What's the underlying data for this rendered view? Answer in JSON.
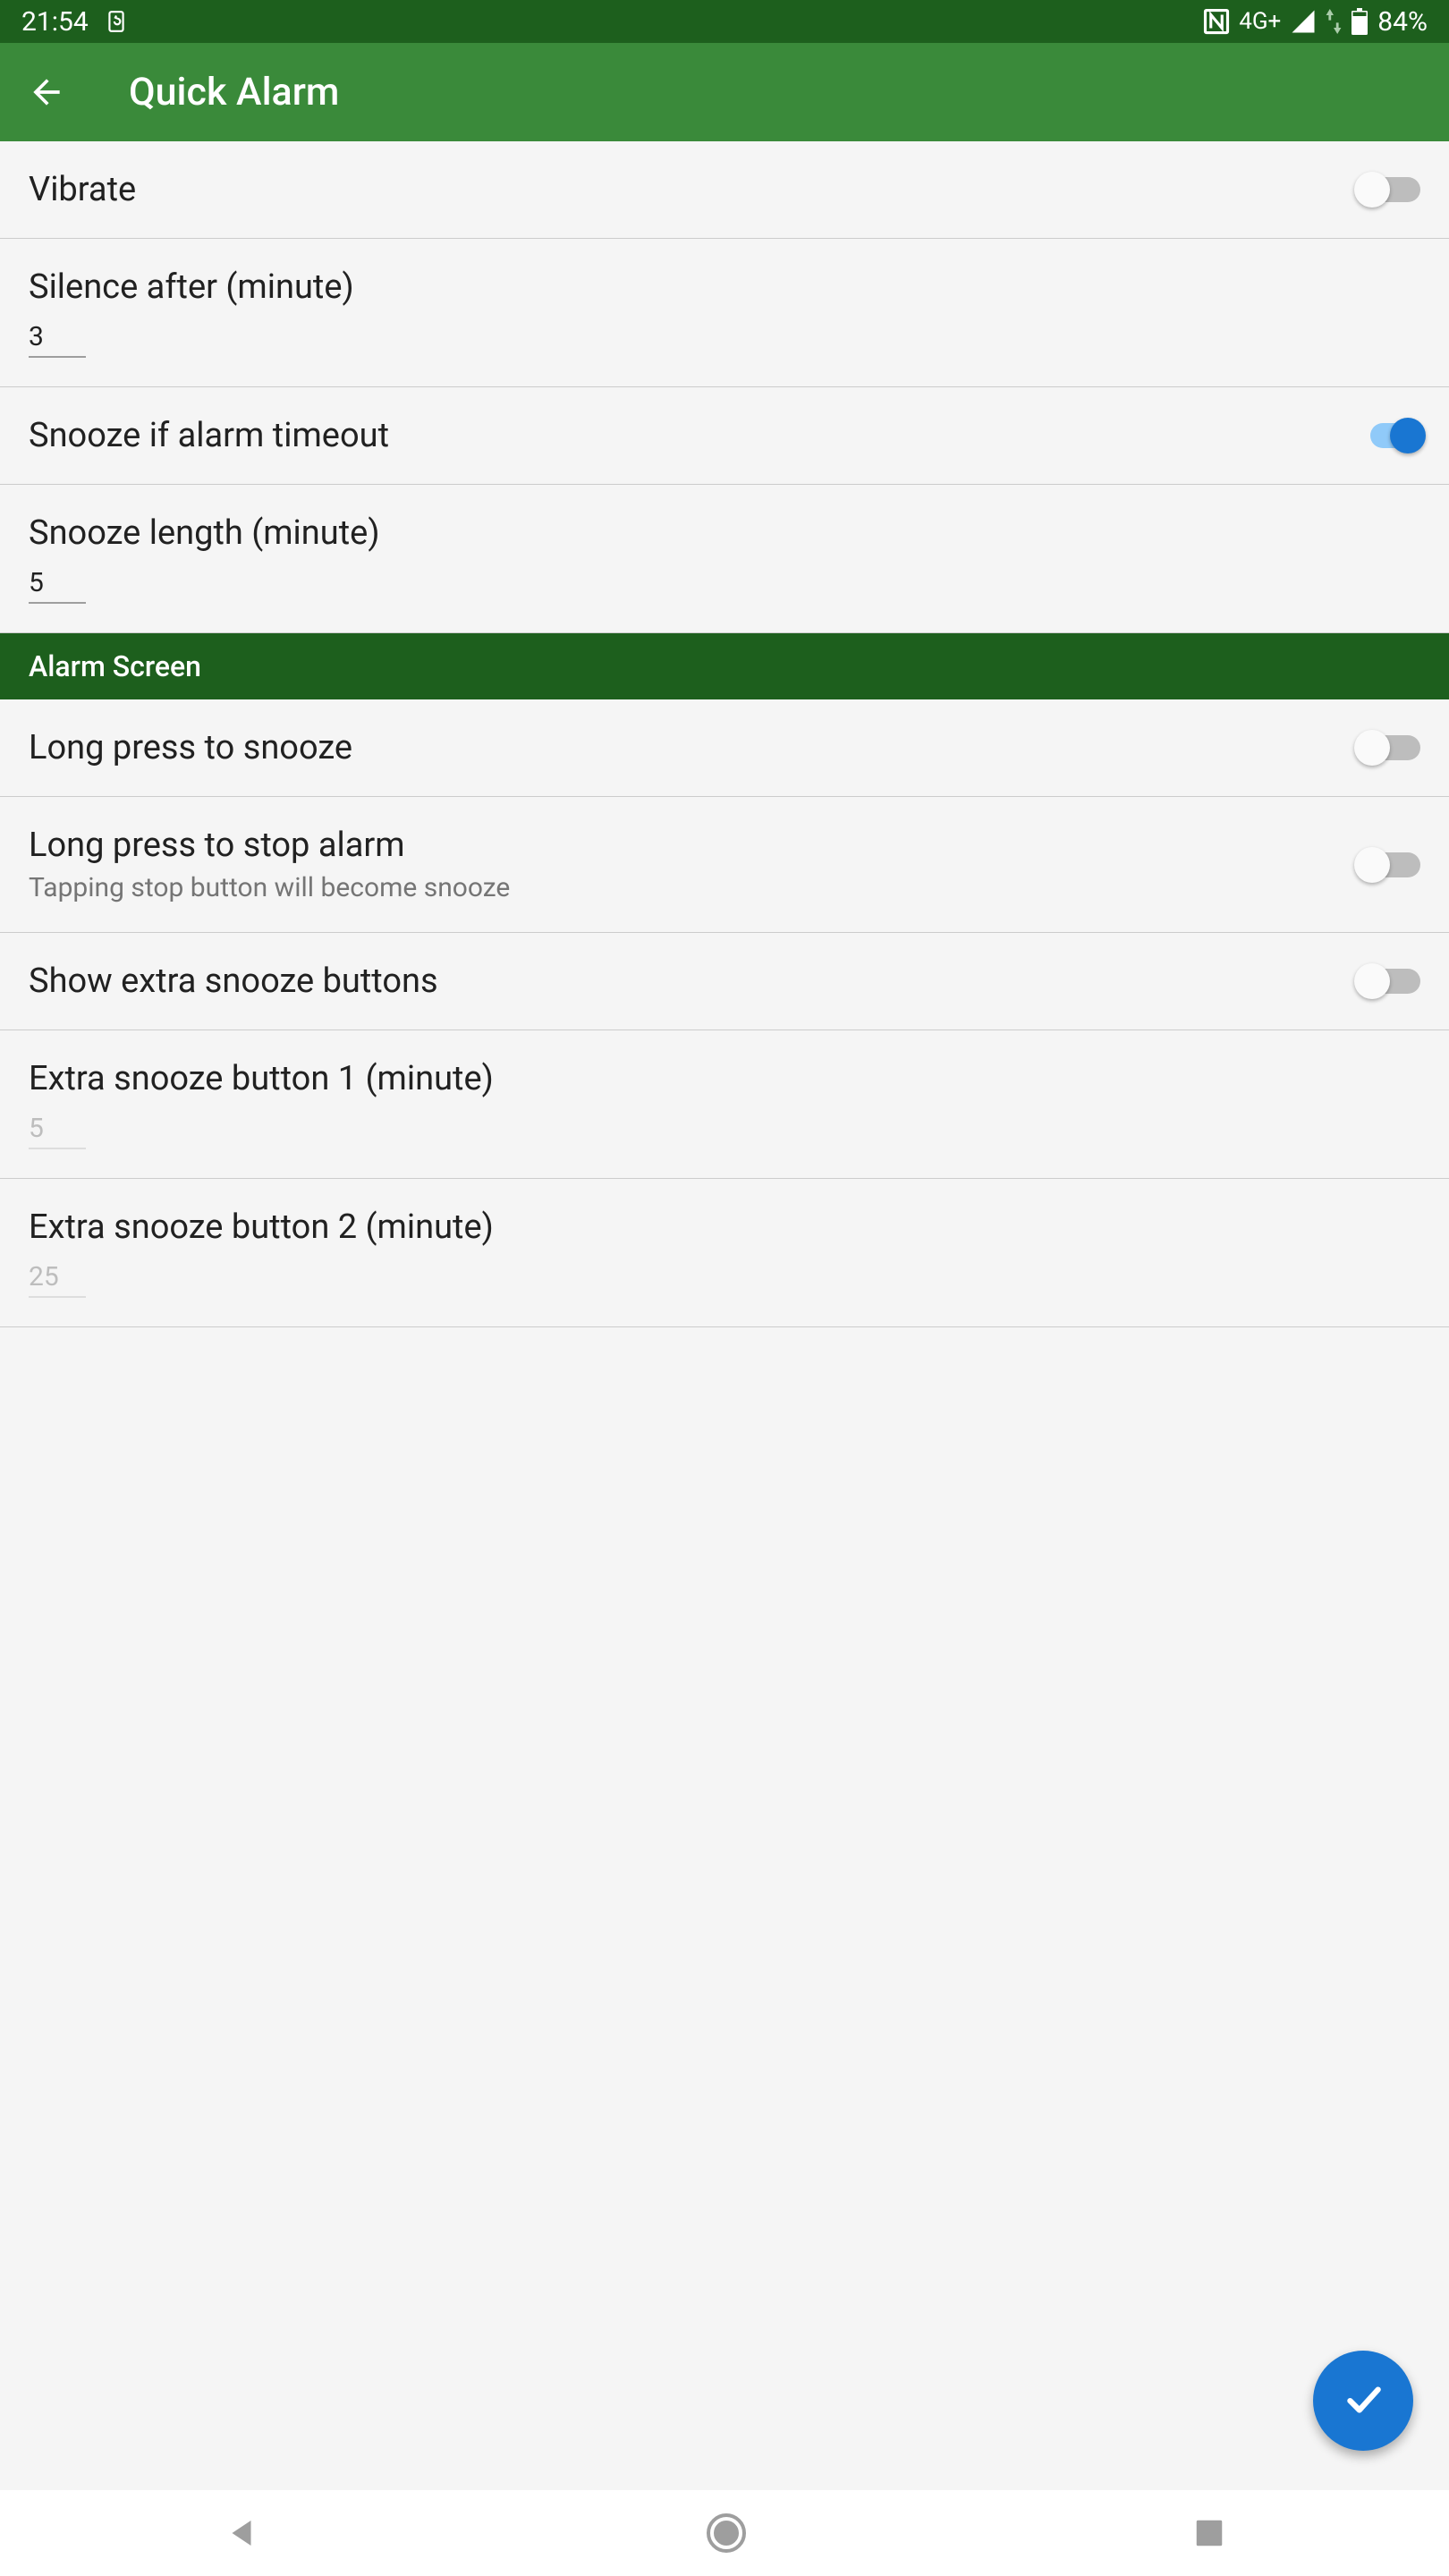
{
  "status_bar": {
    "time": "21:54",
    "network": "4G+",
    "battery": "84%"
  },
  "app_bar": {
    "title": "Quick Alarm"
  },
  "settings": {
    "vibrate": {
      "label": "Vibrate",
      "on": false
    },
    "silence_after": {
      "label": "Silence after (minute)",
      "value": "3"
    },
    "snooze_timeout": {
      "label": "Snooze if alarm timeout",
      "on": true
    },
    "snooze_length": {
      "label": "Snooze length (minute)",
      "value": "5"
    },
    "long_press_snooze": {
      "label": "Long press to snooze",
      "on": false
    },
    "long_press_stop": {
      "label": "Long press to stop alarm",
      "subtitle": "Tapping stop button will become snooze",
      "on": false
    },
    "show_extra_snooze": {
      "label": "Show extra snooze buttons",
      "on": false
    },
    "extra_snooze_1": {
      "label": "Extra snooze button 1 (minute)",
      "value": "5",
      "disabled": true
    },
    "extra_snooze_2": {
      "label": "Extra snooze button 2 (minute)",
      "value": "25",
      "disabled": true
    }
  },
  "sections": {
    "alarm_screen": "Alarm Screen"
  }
}
